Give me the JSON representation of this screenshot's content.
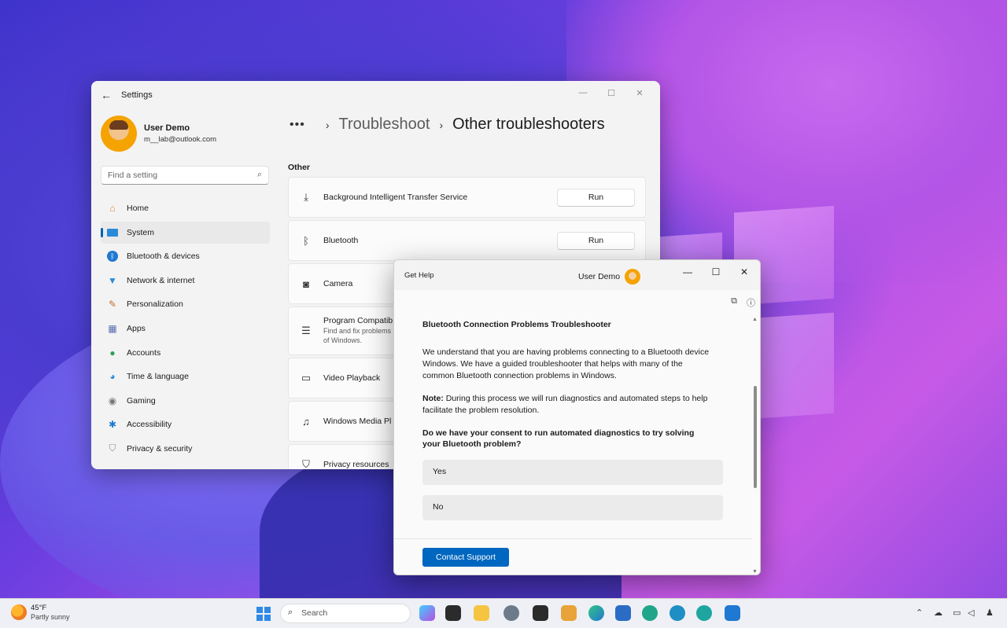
{
  "settings": {
    "window_title": "Settings",
    "user_name": "User Demo",
    "user_email": "m__lab@outlook.com",
    "search_placeholder": "Find a setting",
    "nav": [
      {
        "label": "Home",
        "icon": "home-icon"
      },
      {
        "label": "System",
        "icon": "monitor-icon",
        "active": true
      },
      {
        "label": "Bluetooth & devices",
        "icon": "bluetooth-icon"
      },
      {
        "label": "Network & internet",
        "icon": "wifi-icon"
      },
      {
        "label": "Personalization",
        "icon": "brush-icon"
      },
      {
        "label": "Apps",
        "icon": "apps-icon"
      },
      {
        "label": "Accounts",
        "icon": "person-icon"
      },
      {
        "label": "Time & language",
        "icon": "globe-clock-icon"
      },
      {
        "label": "Gaming",
        "icon": "gamepad-icon"
      },
      {
        "label": "Accessibility",
        "icon": "accessibility-icon"
      },
      {
        "label": "Privacy & security",
        "icon": "shield-icon"
      }
    ],
    "breadcrumb": {
      "level1": "Troubleshoot",
      "level2": "Other troubleshooters"
    },
    "section_label": "Other",
    "troubleshooters": [
      {
        "title": "Background Intelligent Transfer Service",
        "subtitle": "",
        "button": "Run",
        "icon": "download-icon"
      },
      {
        "title": "Bluetooth",
        "subtitle": "",
        "button": "Run",
        "icon": "bluetooth-icon"
      },
      {
        "title": "Camera",
        "subtitle": "",
        "button": "",
        "icon": "camera-icon"
      },
      {
        "title": "Program Compatib",
        "subtitle": "Find and fix problems",
        "subtitle2": "of Windows.",
        "button": "",
        "icon": "list-icon"
      },
      {
        "title": "Video Playback",
        "subtitle": "",
        "button": "",
        "icon": "video-icon"
      },
      {
        "title": "Windows Media Pl",
        "subtitle": "",
        "button": "",
        "icon": "media-icon"
      },
      {
        "title": "Privacy resources",
        "subtitle": "",
        "button": "",
        "icon": "shield-icon"
      }
    ]
  },
  "gethelp": {
    "window_title": "Get Help",
    "user_name": "User Demo",
    "heading": "Bluetooth Connection Problems Troubleshooter",
    "paragraph": "We understand that you are having problems connecting to a Bluetooth device Windows. We have a guided troubleshooter that helps with many of the common Bluetooth connection problems in Windows.",
    "note_label": "Note:",
    "note_text": " During this process we will run diagnostics and automated steps to help facilitate the problem resolution.",
    "question": "Do we have your consent to run automated diagnostics to try solving your Bluetooth problem?",
    "option_yes": "Yes",
    "option_no": "No",
    "contact_button": "Contact Support"
  },
  "taskbar": {
    "temperature": "45°F",
    "condition": "Partly sunny",
    "search_label": "Search",
    "accent": "#0067c0"
  }
}
